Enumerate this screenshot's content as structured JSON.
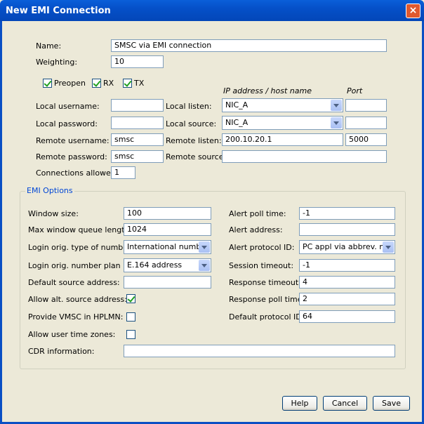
{
  "window": {
    "title": "New EMI Connection",
    "close": "×"
  },
  "conn": {
    "name_label": "Name:",
    "name_value": "SMSC via EMI connection",
    "weighting_label": "Weighting:",
    "weighting_value": "10",
    "preopen_label": "Preopen",
    "preopen_checked": true,
    "rx_label": "RX",
    "rx_checked": true,
    "tx_label": "TX",
    "tx_checked": true,
    "ip_header": "IP address / host name",
    "port_header": "Port",
    "local_username_label": "Local username:",
    "local_username_value": "",
    "local_password_label": "Local password:",
    "local_password_value": "",
    "remote_username_label": "Remote username:",
    "remote_username_value": "smsc",
    "remote_password_label": "Remote password:",
    "remote_password_value": "smsc",
    "connections_allowed_label": "Connections allowed:",
    "connections_allowed_value": "1",
    "local_listen_label": "Local listen:",
    "local_listen_value": "NIC_A",
    "local_listen_port": "",
    "local_source_label": "Local source:",
    "local_source_value": "NIC_A",
    "local_source_port": "",
    "remote_listen_label": "Remote listen:",
    "remote_listen_value": "200.10.20.1",
    "remote_listen_port": "5000",
    "remote_source_label": "Remote source:",
    "remote_source_value": ""
  },
  "emi": {
    "group_label": "EMI Options",
    "window_size_label": "Window size:",
    "window_size_value": "100",
    "max_queue_label": "Max window queue length:",
    "max_queue_value": "1024",
    "ton_label": "Login orig. type of number:",
    "ton_value": "International number",
    "npi_label": "Login orig. number plan ID:",
    "npi_value": "E.164 address",
    "default_source_label": "Default source address:",
    "default_source_value": "",
    "allow_alt_label": "Allow alt. source address:",
    "allow_alt_checked": true,
    "provide_vmsc_label": "Provide VMSC in HPLMN:",
    "provide_vmsc_checked": false,
    "allow_tz_label": "Allow user time zones:",
    "allow_tz_checked": false,
    "cdr_label": "CDR information:",
    "cdr_value": "",
    "alert_poll_label": "Alert poll time:",
    "alert_poll_value": "-1",
    "alert_address_label": "Alert address:",
    "alert_address_value": "",
    "alert_protocol_label": "Alert protocol ID:",
    "alert_protocol_value": "PC appl via abbrev. no.",
    "session_timeout_label": "Session timeout:",
    "session_timeout_value": "-1",
    "response_timeout_label": "Response timeout:",
    "response_timeout_value": "4",
    "response_poll_label": "Response poll time:",
    "response_poll_value": "2",
    "default_protocol_label": "Default protocol ID:",
    "default_protocol_value": "64"
  },
  "buttons": {
    "help": "Help",
    "cancel": "Cancel",
    "save": "Save"
  }
}
